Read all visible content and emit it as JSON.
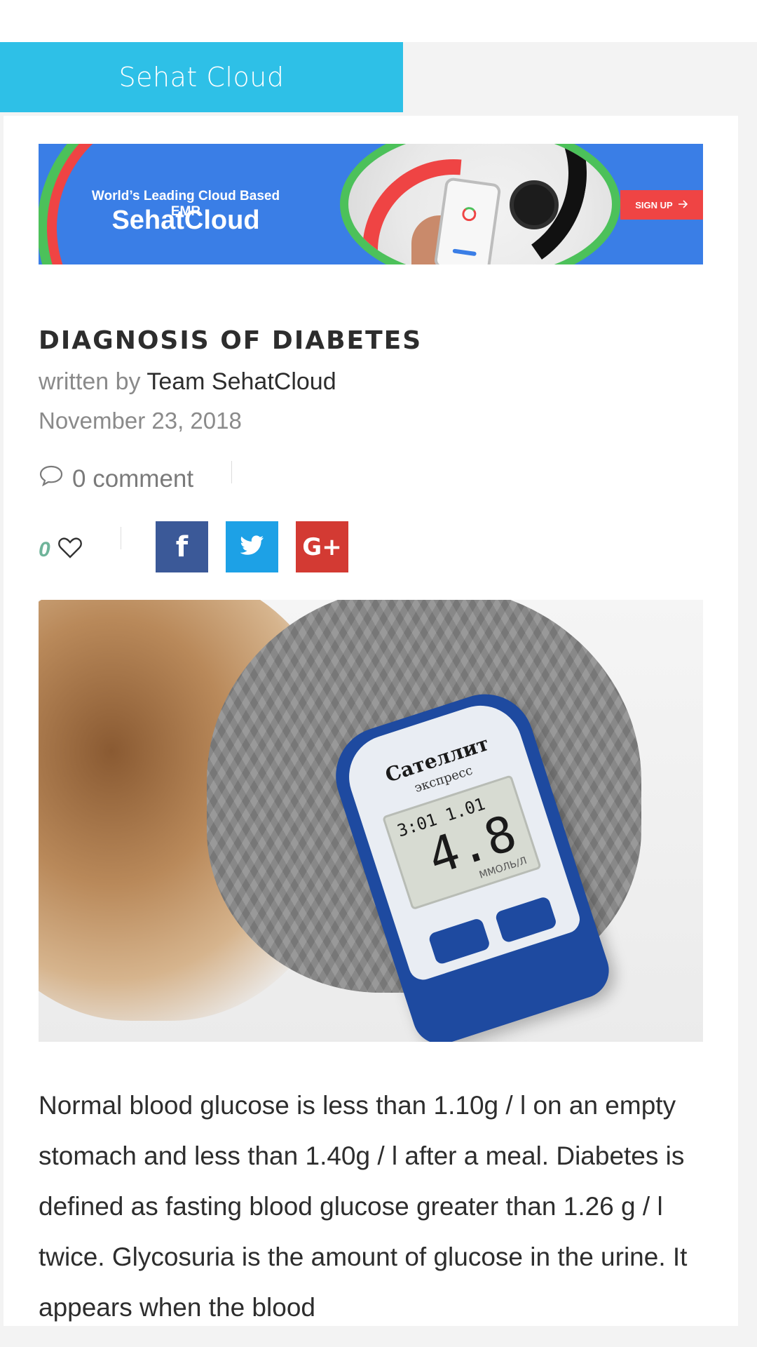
{
  "site": {
    "name": "Sehat Cloud"
  },
  "banner": {
    "tagline": "World’s Leading Cloud Based EMR",
    "brand": "SehatCloud",
    "cta_label": "SIGN UP",
    "cta_icon": "arrow-right-icon",
    "colors": {
      "background": "#3a7ee6",
      "red": "#ef4444",
      "green": "#4cc15a"
    }
  },
  "post": {
    "title": "DIAGNOSIS OF DIABETES",
    "byline_prefix": "written by",
    "author": "Team SehatCloud",
    "date": "November 23, 2018",
    "comments_label": "0 comment",
    "like_count": "0",
    "body": "Normal blood glucose is less than 1.10g / l on an empty stomach and less than 1.40g / l after a meal. Diabetes is defined as fasting blood glucose greater than 1.26 g / l twice. Glycosuria is the amount of glucose in the urine. It appears when the blood"
  },
  "share": {
    "facebook_icon": "facebook-icon",
    "twitter_icon": "twitter-icon",
    "googleplus_icon": "google-plus-icon",
    "colors": {
      "facebook": "#3b5998",
      "twitter": "#1da1e6",
      "googleplus": "#d33a33"
    }
  },
  "hero_photo": {
    "meter_brand": "Сателлит",
    "meter_sub": "экспресс",
    "lcd_small": "3:01 1.01",
    "lcd_big": "4.8",
    "lcd_unit": "ММОЛЬ/Л"
  },
  "theme": {
    "accent": "#2ec0e7"
  }
}
